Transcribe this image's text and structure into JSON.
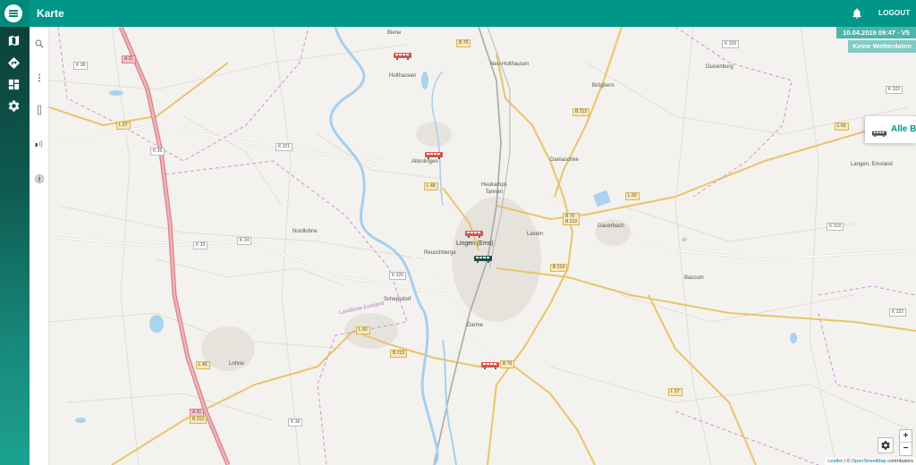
{
  "header": {
    "title": "Karte",
    "logout_label": "LOGOUT"
  },
  "status": {
    "datetime": "10.04.2019 09:47 - V5",
    "weather": "Keine Wetterdaten"
  },
  "bus_panel": {
    "label": "Alle Bu"
  },
  "zoom": {
    "in": "+",
    "out": "−"
  },
  "attribution": {
    "leaflet": "Leaflet",
    "sep": " | © ",
    "osm": "OpenStreetMap",
    "suffix": " contributors"
  },
  "places": {
    "biene": "Biene",
    "holthausen": "Holthausen",
    "neu_holthausen": "Neu-Holthausen",
    "duisenburg": "Duisenburg",
    "brogbern": "Brögbern",
    "altenlingen": "Altenlingen",
    "heukamps_tannen": "Heukamps\nTannen",
    "damaschke": "Damaschke",
    "langen": "Langen, Emsland",
    "nordlohne": "Nordlohne",
    "gauerbach": "Gauerbach",
    "lingen": "Lingen (Ems)",
    "laxten": "Laxten",
    "reuschberge": "Reuschberge",
    "baccum": "Baccum",
    "schepsdorf": "Schepsdorf",
    "darme": "Darme",
    "lohne": "Lohne",
    "lk_emsland": "Landkreis Emsland"
  },
  "roads": {
    "b70a": "B 70",
    "k329": "K 329",
    "k38": "K 38",
    "a31a": "A 31",
    "b213a": "B 213",
    "k322a": "K 322",
    "l67": "L 67",
    "k321": "K 321",
    "k35": "K 35",
    "l60a": "L 60",
    "l48": "L 48",
    "l60b": "L 60",
    "b70b": "B 70\nB 213",
    "k33": "K 33",
    "k34": "K 34",
    "k318": "K 318",
    "b214": "B 214",
    "k320": "K 320",
    "k322b": "K 322",
    "l60c": "L 60",
    "b213b": "B 213",
    "b70c": "B 70",
    "l45": "L 45",
    "l57": "L 57",
    "a31b": "A 31",
    "b213c": "B 213",
    "k36": "K 36"
  },
  "colors": {
    "primary": "#009688",
    "bus_red": "#d9534f",
    "bus_dark": "#1e4d47"
  },
  "icons": [
    "menu-icon",
    "map-icon",
    "directions-icon",
    "dashboard-icon",
    "settings-icon",
    "bell-icon",
    "search-icon",
    "more-icon",
    "ruler-icon",
    "signal-icon",
    "compass-icon",
    "bus-icon"
  ]
}
